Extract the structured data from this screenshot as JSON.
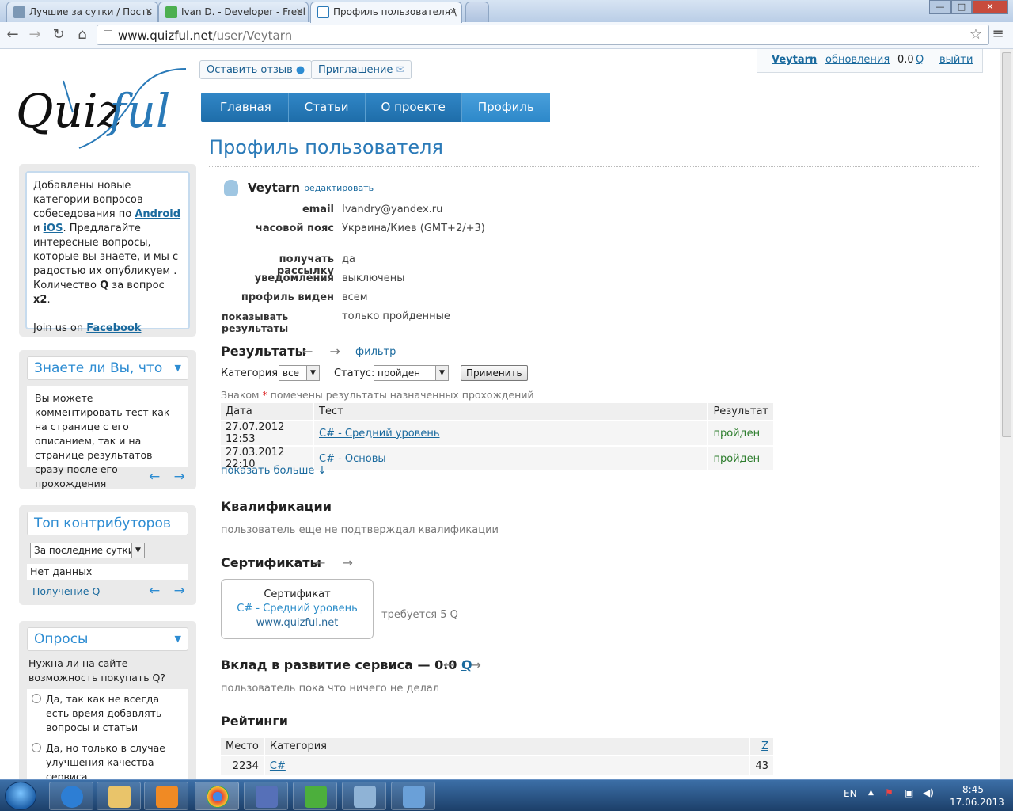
{
  "browser": {
    "tabs": [
      {
        "title": "Лучшие за сутки / Пость",
        "favicon_color": "#7c98b5"
      },
      {
        "title": "Ivan D. - Developer - Freel",
        "favicon_color": "#4caf50"
      },
      {
        "title": "Профиль пользователя \\",
        "favicon_color": "#2a7ab8"
      }
    ],
    "url_host": "www.quizful.net",
    "url_path": "/user/Veytarn",
    "window_controls": {
      "minimize": "—",
      "maximize": "□",
      "close": "✕"
    }
  },
  "site": {
    "logo_text": "Quizful",
    "top_buttons": {
      "feedback": "Оставить отзыв",
      "invite": "Приглашение"
    },
    "user_bar": {
      "username": "Veytarn",
      "updates": "обновления",
      "balance": "0.0",
      "q": "Q",
      "logout": "выйти"
    },
    "nav": [
      "Главная",
      "Статьи",
      "О проекте",
      "Профиль"
    ],
    "page_title": "Профиль пользователя"
  },
  "sidebar": {
    "notice": {
      "line1": "Добавлены новые категории вопросов собеседования по ",
      "android": "Android",
      "and": " и ",
      "ios": "iOS",
      "line2": ". Предлагайте интересные вопросы, которые вы знаете, и мы с радостью их опубликуем . Количество ",
      "q": "Q",
      "line3": " за вопрос ",
      "x2": "x2",
      "line4": ".",
      "join": "Join us on ",
      "facebook": "Facebook"
    },
    "did_you_know": {
      "title": "Знаете ли Вы, что",
      "text": "Вы можете комментировать тест как на странице с его описанием, так и на странице результатов сразу после его прохождения",
      "arrows": "← →"
    },
    "top_contributors": {
      "title": "Топ контрибуторов",
      "period": "За последние сутки",
      "empty": "Нет данных",
      "link": "Получение Q",
      "arrows": "← →"
    },
    "polls": {
      "title": "Опросы",
      "question": "Нужна ли на сайте возможность покупать Q?",
      "options": [
        "Да, так как не всегда есть время добавлять вопросы и статьи",
        "Да, но только в случае улучшения качества сервиса"
      ]
    }
  },
  "profile": {
    "username": "Veytarn",
    "edit": "редактировать",
    "fields": [
      {
        "label": "email",
        "value": "Ivandry@yandex.ru"
      },
      {
        "label": "часовой пояс",
        "value": "Украина/Киев (GMT+2/+3)"
      },
      {
        "label": "получать рассылку",
        "value": "да"
      },
      {
        "label": "уведомления",
        "value": "выключены"
      },
      {
        "label": "профиль виден",
        "value": "всем"
      },
      {
        "label": "показывать результаты",
        "value": "только пройденные"
      }
    ]
  },
  "results": {
    "title": "Результаты",
    "arrows": "← →",
    "filter": "фильтр",
    "category_label": "Категория:",
    "category_value": "все",
    "status_label": "Статус:",
    "status_value": "пройден",
    "apply": "Применить",
    "note_a": "Знаком ",
    "note_star": "*",
    "note_b": " помечены результаты назначенных прохождений",
    "columns": [
      "Дата",
      "Тест",
      "Результат"
    ],
    "rows": [
      {
        "date": "27.07.2012 12:53",
        "test": "C# - Средний уровень",
        "result": "пройден"
      },
      {
        "date": "27.03.2012 22:10",
        "test": "C# - Основы",
        "result": "пройден"
      }
    ],
    "more": "показать больше ↓"
  },
  "qualifications": {
    "title": "Квалификации",
    "text": "пользователь еще не подтверждал квалификации"
  },
  "certificates": {
    "title": "Сертификаты",
    "arrows": "← →",
    "card_title": "Сертификат",
    "card_name": "C# - Средний уровень",
    "card_site": "www.quizful.net",
    "requires": "требуется 5 Q"
  },
  "contribution": {
    "title": "Вклад в развитие сервиса — 0.0",
    "q": "Q",
    "arrows": "← →",
    "text": "пользователь пока что ничего не делал"
  },
  "ratings": {
    "title": "Рейтинги",
    "columns": [
      "Место",
      "Категория",
      "Z"
    ],
    "rows": [
      {
        "place": "2234",
        "category": "C#",
        "score": "43"
      }
    ]
  },
  "taskbar": {
    "lang": "EN",
    "time": "8:45",
    "date": "17.06.2013"
  }
}
